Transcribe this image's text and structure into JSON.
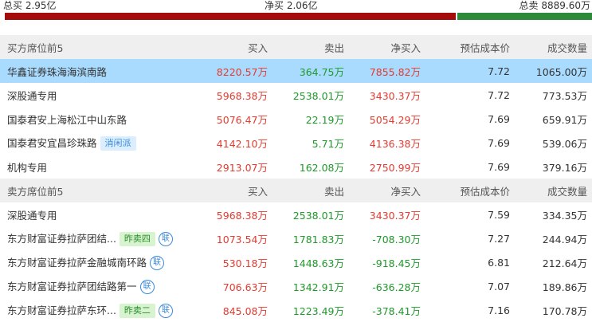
{
  "summary": {
    "total_buy": "总买 2.95亿",
    "net_buy": "净买 2.06亿",
    "total_sell": "总卖 8889.60万",
    "buy_fraction": 0.768,
    "colors": {
      "buy": "#a50d0d",
      "sell": "#2c8a3a"
    }
  },
  "buy_section": {
    "header": {
      "title": "买方席位前5",
      "buy": "买入",
      "sell": "卖出",
      "net": "净买入",
      "cost": "预估成本价",
      "volume": "成交数量"
    },
    "rows": [
      {
        "name": "华鑫证券珠海海滨南路",
        "buy": "8220.57万",
        "sell": "364.75万",
        "net": "7855.82万",
        "cost": "7.72",
        "volume": "1065.00万"
      },
      {
        "name": "深股通专用",
        "buy": "5968.38万",
        "sell": "2538.01万",
        "net": "3430.37万",
        "cost": "7.72",
        "volume": "773.53万"
      },
      {
        "name": "国泰君安上海松江中山东路",
        "buy": "5076.47万",
        "sell": "22.19万",
        "net": "5054.29万",
        "cost": "7.69",
        "volume": "659.91万"
      },
      {
        "name": "国泰君安宜昌珍珠路",
        "tag": "消闲派",
        "buy": "4142.10万",
        "sell": "5.71万",
        "net": "4136.38万",
        "cost": "7.69",
        "volume": "539.06万"
      },
      {
        "name": "机构专用",
        "buy": "2913.07万",
        "sell": "162.08万",
        "net": "2750.99万",
        "cost": "7.69",
        "volume": "379.16万"
      }
    ]
  },
  "sell_section": {
    "header": {
      "title": "卖方席位前5",
      "buy": "买入",
      "sell": "卖出",
      "net": "净买入",
      "cost": "预估成本价",
      "volume": "成交数量"
    },
    "rows": [
      {
        "name": "深股通专用",
        "buy": "5968.38万",
        "sell": "2538.01万",
        "net": "3430.37万",
        "cost": "7.59",
        "volume": "334.35万"
      },
      {
        "name": "东方财富证券拉萨团结...",
        "tag": "昨卖四",
        "lian": "联",
        "buy": "1073.54万",
        "sell": "1781.83万",
        "net": "-708.30万",
        "cost": "7.27",
        "volume": "244.94万"
      },
      {
        "name": "东方财富证券拉萨金融城南环路",
        "lian": "联",
        "buy": "530.18万",
        "sell": "1448.63万",
        "net": "-918.45万",
        "cost": "6.81",
        "volume": "212.64万"
      },
      {
        "name": "东方财富证券拉萨团结路第一",
        "lian": "联",
        "buy": "706.63万",
        "sell": "1342.91万",
        "net": "-636.28万",
        "cost": "7.07",
        "volume": "189.86万"
      },
      {
        "name": "东方财富证券拉萨东环...",
        "tag": "昨卖二",
        "lian": "联",
        "buy": "845.08万",
        "sell": "1223.49万",
        "net": "-378.41万",
        "cost": "7.16",
        "volume": "170.78万"
      }
    ]
  }
}
